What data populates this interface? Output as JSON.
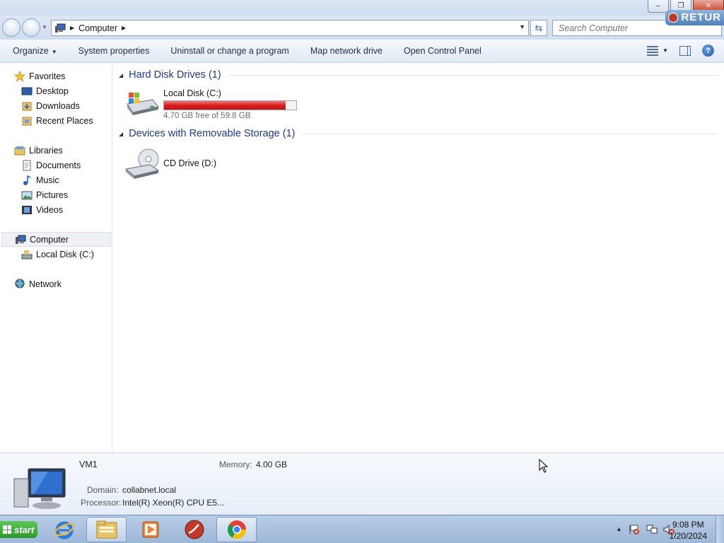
{
  "window": {
    "minimize_glyph": "–",
    "maximize_glyph": "❐",
    "close_glyph": "✕",
    "overlay_label": "RETUR"
  },
  "address": {
    "location": "Computer",
    "search_placeholder": "Search Computer"
  },
  "toolbar": {
    "organize": "Organize",
    "system_properties": "System properties",
    "uninstall": "Uninstall or change a program",
    "map_drive": "Map network drive",
    "control_panel": "Open Control Panel"
  },
  "sidebar": {
    "favorites": "Favorites",
    "desktop": "Desktop",
    "downloads": "Downloads",
    "recent": "Recent Places",
    "libraries": "Libraries",
    "documents": "Documents",
    "music": "Music",
    "pictures": "Pictures",
    "videos": "Videos",
    "computer": "Computer",
    "local_disk": "Local Disk (C:)",
    "network": "Network"
  },
  "content": {
    "hdd_group": "Hard Disk Drives (1)",
    "removable_group": "Devices with Removable Storage (1)",
    "drive_c": {
      "name": "Local Disk (C:)",
      "free_text": "4.70 GB free of 59.8 GB",
      "used_fraction": 0.921
    },
    "drive_d": {
      "name": "CD Drive (D:)"
    }
  },
  "details": {
    "name": "VM1",
    "memory_label": "Memory:",
    "memory_value": "4.00 GB",
    "domain_label": "Domain:",
    "domain_value": "collabnet.local",
    "processor_label": "Processor:",
    "processor_value": "Intel(R) Xeon(R) CPU E5..."
  },
  "taskbar": {
    "start": "start",
    "time": "9:08 PM",
    "date": "1/20/2024"
  },
  "colors": {
    "accent": "#1e3a8a",
    "disk_bar": "#d81e1e",
    "start_green": "#2a9a2a"
  }
}
